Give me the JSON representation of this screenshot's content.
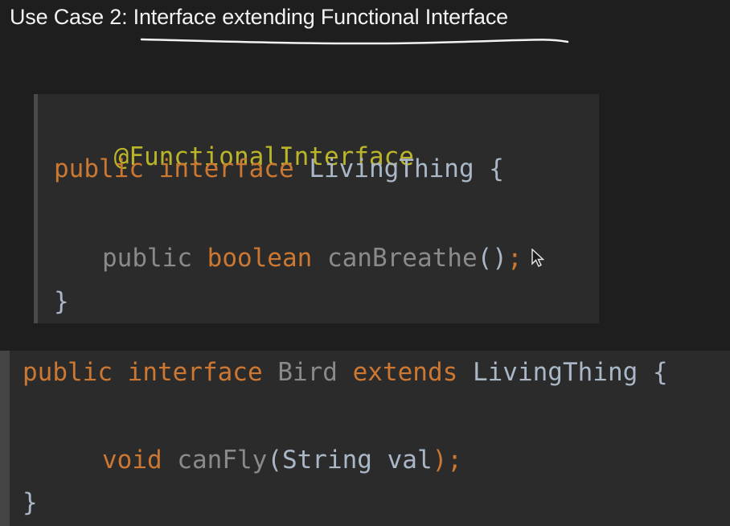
{
  "slide": {
    "title_prefix": "Use Case 2: ",
    "title_main": "Interface extending Functional Interface"
  },
  "code_block_1": {
    "annotation": "@FunctionalInterface",
    "line2": {
      "kw_public": "public",
      "kw_interface": "interface",
      "name": "LivingThing",
      "brace": "{"
    },
    "line3": {
      "kw_public": "public",
      "kw_type": "boolean",
      "method": "canBreathe",
      "parens": "()",
      "semicolon": ";"
    },
    "close": "}"
  },
  "code_block_2": {
    "line1": {
      "kw_public": "public",
      "kw_interface": "interface",
      "name": "Bird",
      "kw_extends": "extends",
      "parent": "LivingThing",
      "brace": "{"
    },
    "line2": {
      "kw_type": "void",
      "method": "canFly",
      "open": "(",
      "param_type": "String",
      "param_name": "val",
      "close": ");"
    },
    "close": "}"
  },
  "colors": {
    "keyword": "#cc7832",
    "annotation": "#bbb529",
    "type": "#a9b7c6",
    "dimmed": "#8a8a8a",
    "background": "#1e1e1e",
    "editor": "#2b2b2b"
  },
  "icons": {
    "pointer": "mouse-pointer-icon"
  }
}
